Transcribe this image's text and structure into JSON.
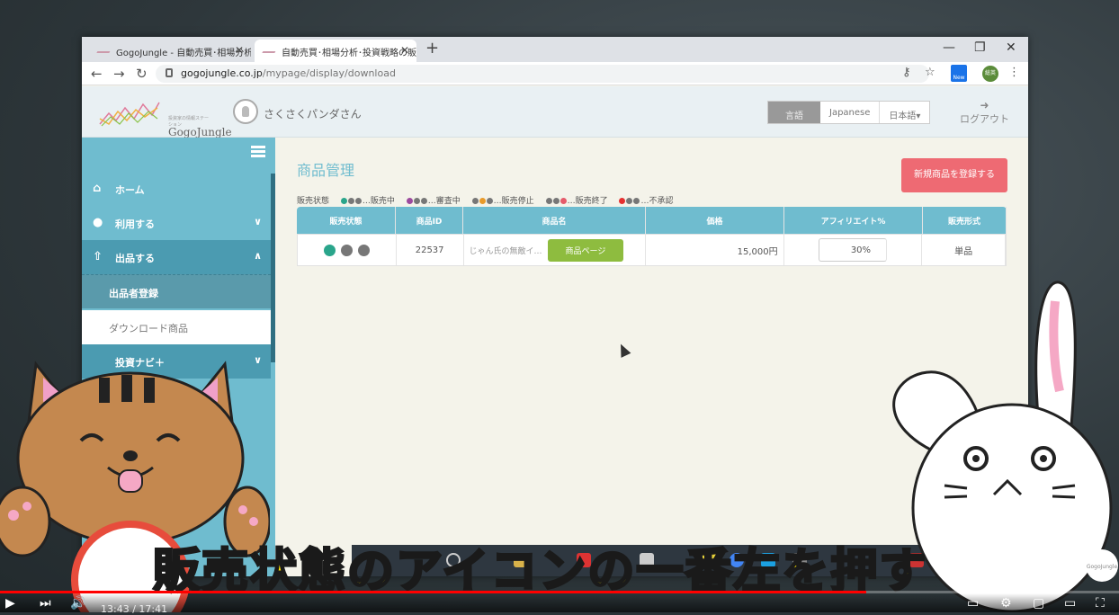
{
  "browser": {
    "tabs": [
      {
        "title": "GogoJungle - 自動売買･相場分析"
      },
      {
        "title": "自動売買･相場分析･投資戦略の販"
      }
    ],
    "url_host": "gogojungle.co.jp",
    "url_path": "/mypage/display/download",
    "new_badge": "New",
    "profile_initials": "総英"
  },
  "header": {
    "logo_text": "GogoJungle",
    "logo_tagline": "投資家の情報ステーション",
    "username": "さくさくパンダさん",
    "lang_label": "言語",
    "lang_option": "Japanese",
    "lang_selected": "日本語▾",
    "logout": "ログアウト"
  },
  "sidebar": {
    "items": [
      {
        "label": "ホーム"
      },
      {
        "label": "利用する"
      },
      {
        "label": "出品する"
      },
      {
        "label": "出品者登録"
      },
      {
        "label": "ダウンロード商品"
      },
      {
        "label": "投資ナビ＋"
      }
    ]
  },
  "main": {
    "title": "商品管理",
    "new_button": "新規商品を登録する",
    "legend_label": "販売状態",
    "legend": [
      {
        "text": "…販売中",
        "colors": [
          "#2aa58b",
          "#777777",
          "#777777"
        ]
      },
      {
        "text": "…審査中",
        "colors": [
          "#9c4a9e",
          "#777777",
          "#777777"
        ]
      },
      {
        "text": "…販売停止",
        "colors": [
          "#777777",
          "#e89a2a",
          "#777777"
        ]
      },
      {
        "text": "…販売終了",
        "colors": [
          "#777777",
          "#777777",
          "#e55b6a"
        ]
      },
      {
        "text": "…不承認",
        "colors": [
          "#e53030",
          "#777777",
          "#777777"
        ]
      }
    ],
    "columns": [
      "販売状態",
      "商品ID",
      "商品名",
      "価格",
      "アフィリエイト%",
      "販売形式"
    ],
    "rows": [
      {
        "status_colors": [
          "#2aa58b",
          "#777777",
          "#777777"
        ],
        "id": "22537",
        "name": "じゃん氏の無敵イ…",
        "page_button": "商品ページ",
        "price": "15,000円",
        "affiliate": "30",
        "affiliate_unit": "%",
        "type": "単品"
      }
    ]
  },
  "caption": "販売状態のアイコンの一番左を押す",
  "video": {
    "time": "13:43 / 17:41",
    "progress": 0.774
  }
}
